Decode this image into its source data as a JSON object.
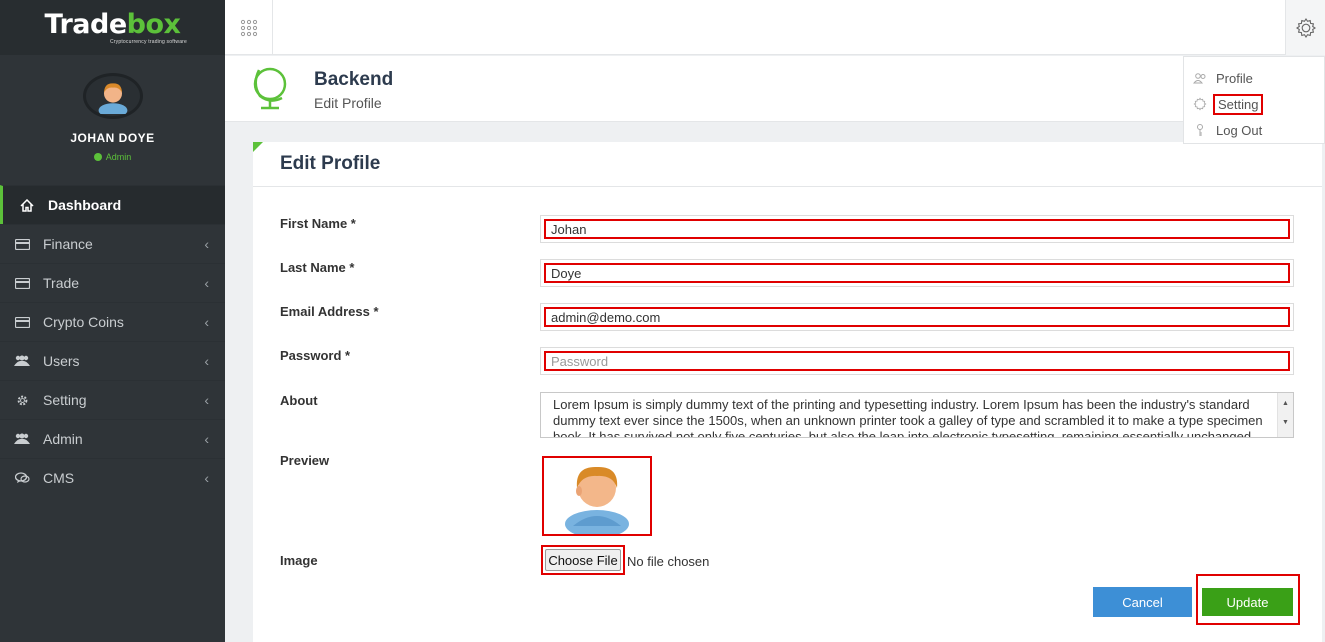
{
  "brand": {
    "logo_main": "Trade",
    "logo_accent": "box",
    "tagline": "Cryptocurrency trading software"
  },
  "user": {
    "name": "JOHAN DOYE",
    "role": "Admin"
  },
  "sidebar": {
    "items": [
      {
        "label": "Dashboard",
        "icon": "home-icon",
        "active": true
      },
      {
        "label": "Finance",
        "icon": "card-icon"
      },
      {
        "label": "Trade",
        "icon": "card-icon"
      },
      {
        "label": "Crypto Coins",
        "icon": "card-icon"
      },
      {
        "label": "Users",
        "icon": "users-icon"
      },
      {
        "label": "Setting",
        "icon": "gear-icon"
      },
      {
        "label": "Admin",
        "icon": "users-icon"
      },
      {
        "label": "CMS",
        "icon": "chat-icon"
      }
    ]
  },
  "header": {
    "title": "Backend",
    "subtitle": "Edit Profile"
  },
  "user_menu": {
    "profile": "Profile",
    "setting": "Setting",
    "logout": "Log Out"
  },
  "form": {
    "title": "Edit Profile",
    "first_name": {
      "label": "First Name *",
      "value": "Johan"
    },
    "last_name": {
      "label": "Last Name *",
      "value": "Doye"
    },
    "email": {
      "label": "Email Address *",
      "value": "admin@demo.com"
    },
    "password": {
      "label": "Password *",
      "placeholder": "Password"
    },
    "about": {
      "label": "About",
      "value": "Lorem Ipsum is simply dummy text of the printing and typesetting industry. Lorem Ipsum has been the industry's standard dummy text ever since the 1500s, when an unknown printer took a galley of type and scrambled it to make a type specimen book. It has survived not only five centuries, but also the leap into electronic typesetting, remaining essentially unchanged."
    },
    "preview": {
      "label": "Preview"
    },
    "image": {
      "label": "Image",
      "button": "Choose File",
      "status": "No file chosen"
    },
    "cancel_label": "Cancel",
    "update_label": "Update"
  },
  "colors": {
    "accent": "#5cc13a",
    "sidebar": "#2f3438",
    "cancel": "#3d8fd6",
    "update": "#3aa017",
    "highlight": "#e00000"
  }
}
